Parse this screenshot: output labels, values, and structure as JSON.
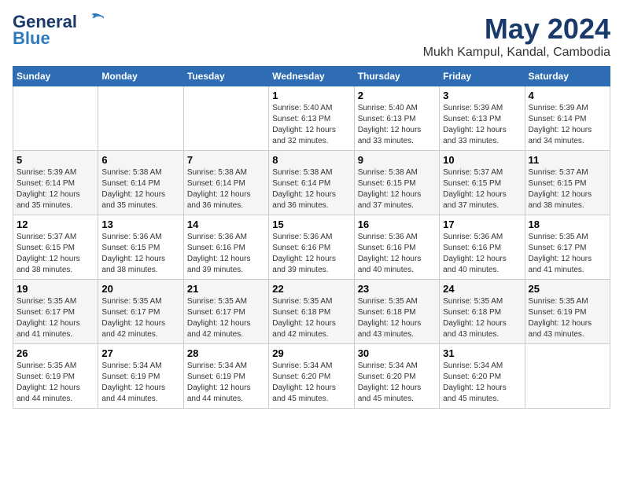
{
  "header": {
    "logo_line1": "General",
    "logo_line2": "Blue",
    "month": "May 2024",
    "location": "Mukh Kampul, Kandal, Cambodia"
  },
  "weekdays": [
    "Sunday",
    "Monday",
    "Tuesday",
    "Wednesday",
    "Thursday",
    "Friday",
    "Saturday"
  ],
  "weeks": [
    [
      {
        "day": "",
        "info": ""
      },
      {
        "day": "",
        "info": ""
      },
      {
        "day": "",
        "info": ""
      },
      {
        "day": "1",
        "info": "Sunrise: 5:40 AM\nSunset: 6:13 PM\nDaylight: 12 hours\nand 32 minutes."
      },
      {
        "day": "2",
        "info": "Sunrise: 5:40 AM\nSunset: 6:13 PM\nDaylight: 12 hours\nand 33 minutes."
      },
      {
        "day": "3",
        "info": "Sunrise: 5:39 AM\nSunset: 6:13 PM\nDaylight: 12 hours\nand 33 minutes."
      },
      {
        "day": "4",
        "info": "Sunrise: 5:39 AM\nSunset: 6:14 PM\nDaylight: 12 hours\nand 34 minutes."
      }
    ],
    [
      {
        "day": "5",
        "info": "Sunrise: 5:39 AM\nSunset: 6:14 PM\nDaylight: 12 hours\nand 35 minutes."
      },
      {
        "day": "6",
        "info": "Sunrise: 5:38 AM\nSunset: 6:14 PM\nDaylight: 12 hours\nand 35 minutes."
      },
      {
        "day": "7",
        "info": "Sunrise: 5:38 AM\nSunset: 6:14 PM\nDaylight: 12 hours\nand 36 minutes."
      },
      {
        "day": "8",
        "info": "Sunrise: 5:38 AM\nSunset: 6:14 PM\nDaylight: 12 hours\nand 36 minutes."
      },
      {
        "day": "9",
        "info": "Sunrise: 5:38 AM\nSunset: 6:15 PM\nDaylight: 12 hours\nand 37 minutes."
      },
      {
        "day": "10",
        "info": "Sunrise: 5:37 AM\nSunset: 6:15 PM\nDaylight: 12 hours\nand 37 minutes."
      },
      {
        "day": "11",
        "info": "Sunrise: 5:37 AM\nSunset: 6:15 PM\nDaylight: 12 hours\nand 38 minutes."
      }
    ],
    [
      {
        "day": "12",
        "info": "Sunrise: 5:37 AM\nSunset: 6:15 PM\nDaylight: 12 hours\nand 38 minutes."
      },
      {
        "day": "13",
        "info": "Sunrise: 5:36 AM\nSunset: 6:15 PM\nDaylight: 12 hours\nand 38 minutes."
      },
      {
        "day": "14",
        "info": "Sunrise: 5:36 AM\nSunset: 6:16 PM\nDaylight: 12 hours\nand 39 minutes."
      },
      {
        "day": "15",
        "info": "Sunrise: 5:36 AM\nSunset: 6:16 PM\nDaylight: 12 hours\nand 39 minutes."
      },
      {
        "day": "16",
        "info": "Sunrise: 5:36 AM\nSunset: 6:16 PM\nDaylight: 12 hours\nand 40 minutes."
      },
      {
        "day": "17",
        "info": "Sunrise: 5:36 AM\nSunset: 6:16 PM\nDaylight: 12 hours\nand 40 minutes."
      },
      {
        "day": "18",
        "info": "Sunrise: 5:35 AM\nSunset: 6:17 PM\nDaylight: 12 hours\nand 41 minutes."
      }
    ],
    [
      {
        "day": "19",
        "info": "Sunrise: 5:35 AM\nSunset: 6:17 PM\nDaylight: 12 hours\nand 41 minutes."
      },
      {
        "day": "20",
        "info": "Sunrise: 5:35 AM\nSunset: 6:17 PM\nDaylight: 12 hours\nand 42 minutes."
      },
      {
        "day": "21",
        "info": "Sunrise: 5:35 AM\nSunset: 6:17 PM\nDaylight: 12 hours\nand 42 minutes."
      },
      {
        "day": "22",
        "info": "Sunrise: 5:35 AM\nSunset: 6:18 PM\nDaylight: 12 hours\nand 42 minutes."
      },
      {
        "day": "23",
        "info": "Sunrise: 5:35 AM\nSunset: 6:18 PM\nDaylight: 12 hours\nand 43 minutes."
      },
      {
        "day": "24",
        "info": "Sunrise: 5:35 AM\nSunset: 6:18 PM\nDaylight: 12 hours\nand 43 minutes."
      },
      {
        "day": "25",
        "info": "Sunrise: 5:35 AM\nSunset: 6:19 PM\nDaylight: 12 hours\nand 43 minutes."
      }
    ],
    [
      {
        "day": "26",
        "info": "Sunrise: 5:35 AM\nSunset: 6:19 PM\nDaylight: 12 hours\nand 44 minutes."
      },
      {
        "day": "27",
        "info": "Sunrise: 5:34 AM\nSunset: 6:19 PM\nDaylight: 12 hours\nand 44 minutes."
      },
      {
        "day": "28",
        "info": "Sunrise: 5:34 AM\nSunset: 6:19 PM\nDaylight: 12 hours\nand 44 minutes."
      },
      {
        "day": "29",
        "info": "Sunrise: 5:34 AM\nSunset: 6:20 PM\nDaylight: 12 hours\nand 45 minutes."
      },
      {
        "day": "30",
        "info": "Sunrise: 5:34 AM\nSunset: 6:20 PM\nDaylight: 12 hours\nand 45 minutes."
      },
      {
        "day": "31",
        "info": "Sunrise: 5:34 AM\nSunset: 6:20 PM\nDaylight: 12 hours\nand 45 minutes."
      },
      {
        "day": "",
        "info": ""
      }
    ]
  ]
}
